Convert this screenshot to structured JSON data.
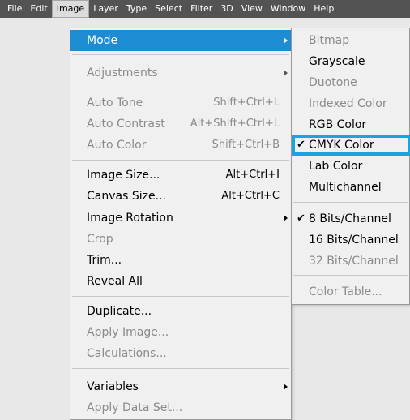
{
  "menubar": {
    "items": [
      "File",
      "Edit",
      "Image",
      "Layer",
      "Type",
      "Select",
      "Filter",
      "3D",
      "View",
      "Window",
      "Help"
    ]
  },
  "image_menu": {
    "mode": "Mode",
    "adjustments": "Adjustments",
    "auto_tone": {
      "label": "Auto Tone",
      "shortcut": "Shift+Ctrl+L"
    },
    "auto_contrast": {
      "label": "Auto Contrast",
      "shortcut": "Alt+Shift+Ctrl+L"
    },
    "auto_color": {
      "label": "Auto Color",
      "shortcut": "Shift+Ctrl+B"
    },
    "image_size": {
      "label": "Image Size...",
      "shortcut": "Alt+Ctrl+I"
    },
    "canvas_size": {
      "label": "Canvas Size...",
      "shortcut": "Alt+Ctrl+C"
    },
    "image_rotation": "Image Rotation",
    "crop": "Crop",
    "trim": "Trim...",
    "reveal_all": "Reveal All",
    "duplicate": "Duplicate...",
    "apply_image": "Apply Image...",
    "calculations": "Calculations...",
    "variables": "Variables",
    "apply_data_set": "Apply Data Set..."
  },
  "mode_menu": {
    "bitmap": "Bitmap",
    "grayscale": "Grayscale",
    "duotone": "Duotone",
    "indexed_color": "Indexed Color",
    "rgb_color": "RGB Color",
    "cmyk_color": "CMYK Color",
    "lab_color": "Lab Color",
    "multichannel": "Multichannel",
    "bits8": "8 Bits/Channel",
    "bits16": "16 Bits/Channel",
    "bits32": "32 Bits/Channel",
    "color_table": "Color Table...",
    "check_mark": "✔"
  },
  "colors": {
    "highlight": "#1e8cd2",
    "annotation_outline": "#1aa3dd",
    "menubar_bg": "#535353"
  }
}
